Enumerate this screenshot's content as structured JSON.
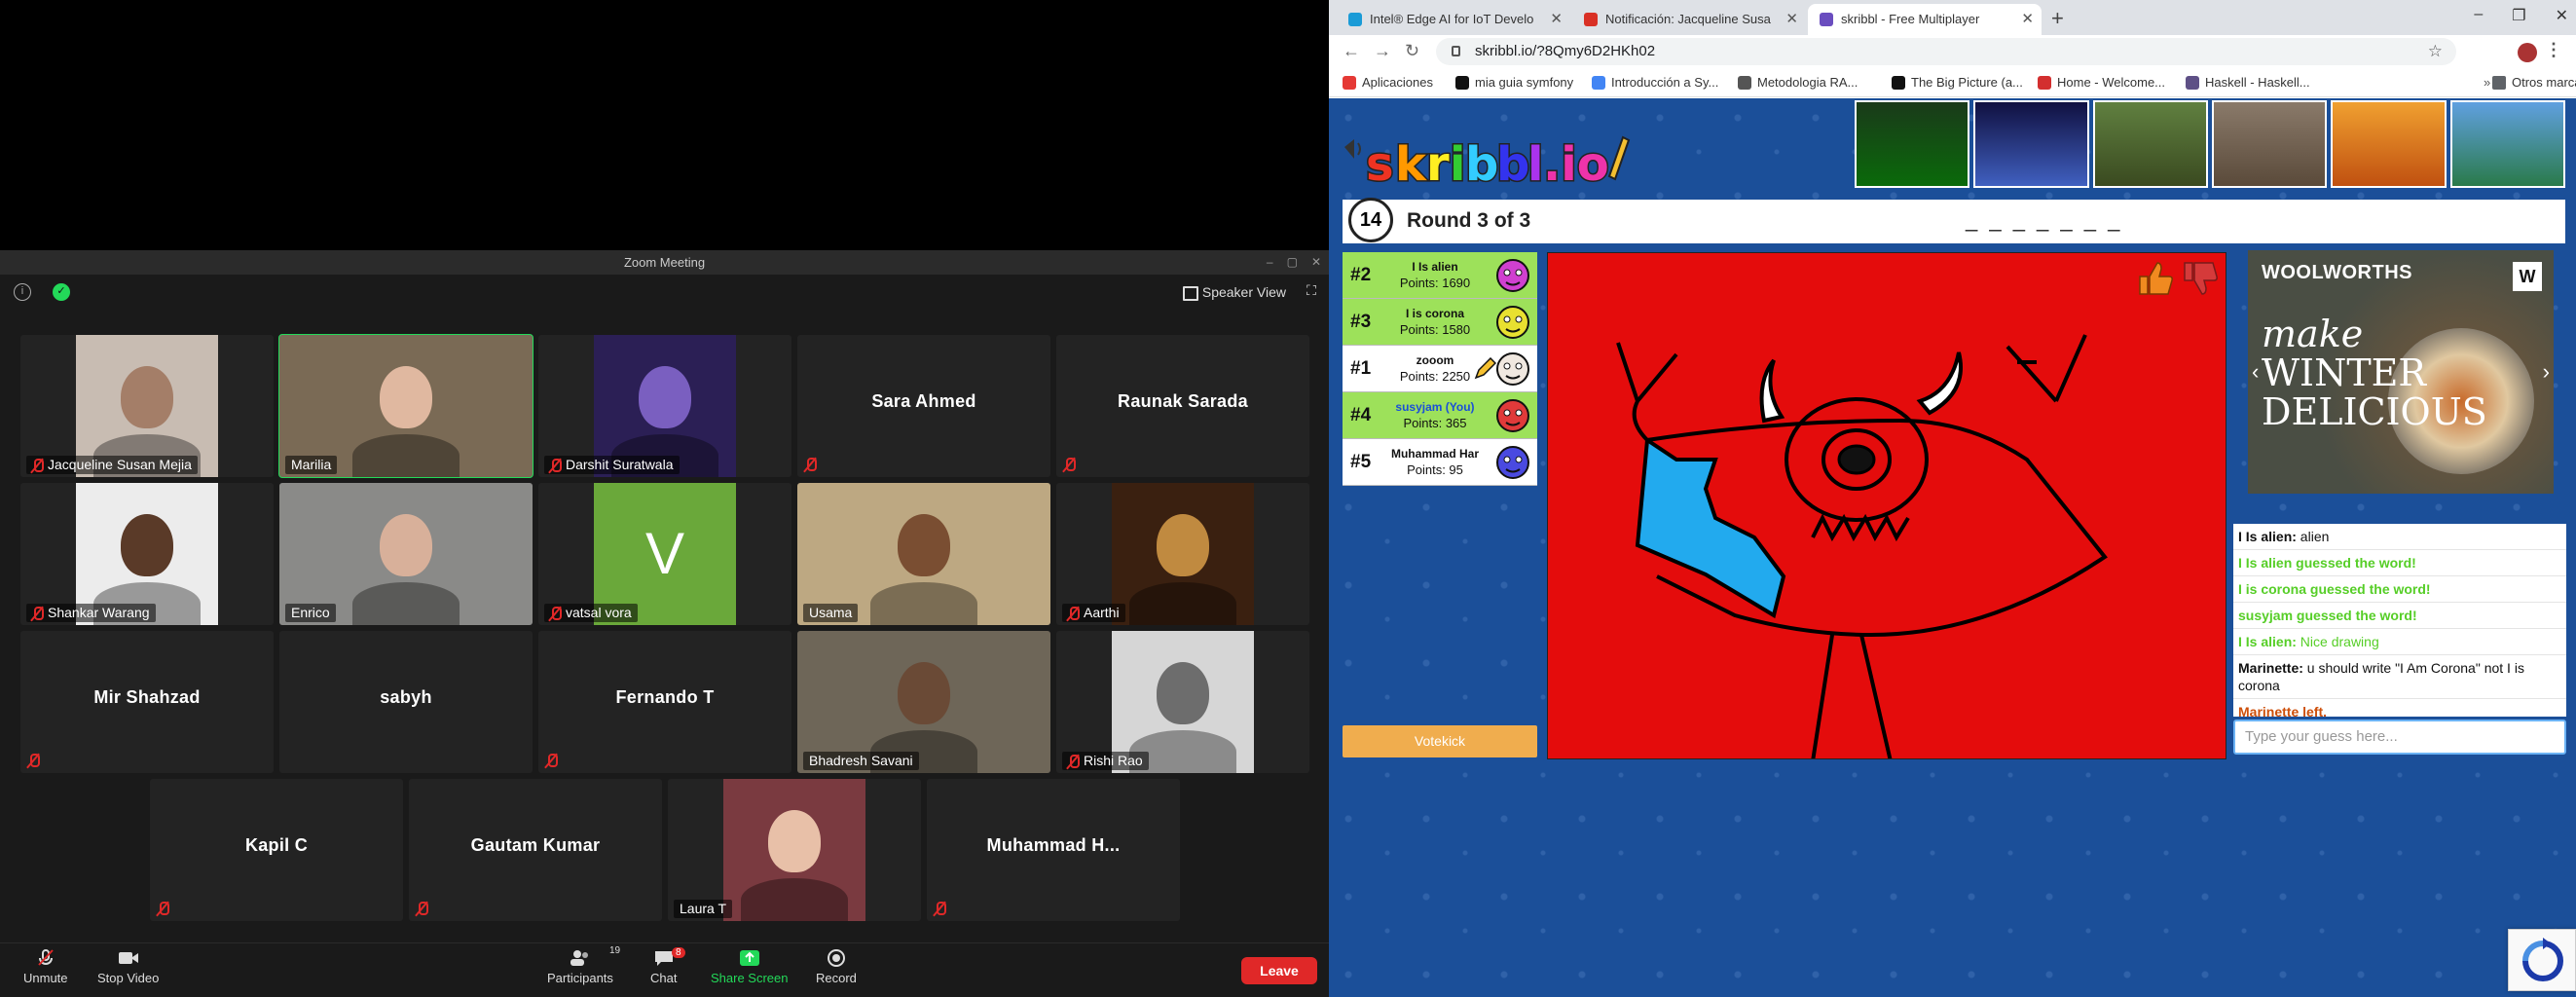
{
  "zoom": {
    "window_title": "Zoom Meeting",
    "speaker_view": "Speaker View",
    "participants": [
      {
        "name": "Jacqueline Susan Mejia",
        "muted": true,
        "video": true,
        "bg": "#c8bcb2",
        "face": "#a47e68"
      },
      {
        "name": "Marilia",
        "muted": false,
        "video": true,
        "active": true,
        "bg": "#7a6a55",
        "face": "#e0b8a0"
      },
      {
        "name": "Darshit Suratwala",
        "muted": true,
        "video": true,
        "bg": "#2b1f55",
        "face": "#7a5fc0"
      },
      {
        "name": "Sara Ahmed",
        "muted": true,
        "video": false
      },
      {
        "name": "Raunak Sarada",
        "muted": true,
        "video": false
      },
      {
        "name": "Shankar Warang",
        "muted": true,
        "video": true,
        "bg": "#ececec",
        "face": "#5a3a28"
      },
      {
        "name": "Enrico",
        "muted": false,
        "video": true,
        "bg": "#8a8a88",
        "face": "#d8b09a"
      },
      {
        "name": "vatsal vora",
        "muted": true,
        "video": false,
        "initial": "V"
      },
      {
        "name": "Usama",
        "muted": false,
        "video": true,
        "bg": "#bda882",
        "face": "#7a4e32"
      },
      {
        "name": "Aarthi",
        "muted": true,
        "video": true,
        "bg": "#3a2010",
        "face": "#c08a40"
      },
      {
        "name": "Mir Shahzad",
        "muted": true,
        "video": false
      },
      {
        "name": "sabyh",
        "muted": false,
        "video": false
      },
      {
        "name": "Fernando T",
        "muted": true,
        "video": false
      },
      {
        "name": "Bhadresh Savani",
        "muted": false,
        "video": true,
        "bg": "#6e6658",
        "face": "#6a4a36"
      },
      {
        "name": "Rishi Rao",
        "muted": true,
        "video": true,
        "bg": "#d6d6d6",
        "face": "#6d6d6d"
      },
      {
        "name": "Kapil C",
        "muted": true,
        "video": false
      },
      {
        "name": "Gautam Kumar",
        "muted": true,
        "video": false
      },
      {
        "name": "Laura T",
        "muted": false,
        "video": true,
        "bg": "#7a3a40",
        "face": "#e8c0a8"
      },
      {
        "name": "Muhammad H...",
        "muted": true,
        "video": false
      }
    ],
    "toolbar": {
      "unmute": "Unmute",
      "stop_video": "Stop Video",
      "participants": "Participants",
      "participants_count": "19",
      "chat": "Chat",
      "chat_badge": "8",
      "share_screen": "Share Screen",
      "record": "Record",
      "leave": "Leave"
    }
  },
  "browser": {
    "tabs": [
      {
        "title": "Intel® Edge AI for IoT Develo",
        "color": "#1a9bd7"
      },
      {
        "title": "Notificación: Jacqueline Susa",
        "color": "#d93025"
      },
      {
        "title": "skribbl - Free Multiplayer",
        "color": "#6a4dbf",
        "active": true
      }
    ],
    "url": "skribbl.io/?8Qmy6D2HKh02",
    "bookmarks": [
      {
        "label": "Aplicaciones",
        "color": "#e53935"
      },
      {
        "label": "mia guia symfony",
        "color": "#111"
      },
      {
        "label": "Introducción a Sy...",
        "color": "#4285f4"
      },
      {
        "label": "Metodologia RA...",
        "color": "#555"
      },
      {
        "label": "The Big Picture (a...",
        "color": "#111"
      },
      {
        "label": "Home - Welcome...",
        "color": "#d32f2f"
      },
      {
        "label": "Haskell - Haskell...",
        "color": "#5e5086"
      }
    ],
    "other_bookmarks": "Otros marcadores"
  },
  "skribbl": {
    "timer": "14",
    "round_text": "Round 3 of 3",
    "word_hint": "_ _ _ _ _ _ _",
    "players": [
      {
        "rank": "#2",
        "name": "I Is alien",
        "points": "Points: 1690",
        "bg": "#9de15a",
        "av": "#d040d0"
      },
      {
        "rank": "#3",
        "name": "I is corona",
        "points": "Points: 1580",
        "bg": "#9de15a",
        "av": "#e8e030"
      },
      {
        "rank": "#1",
        "name": "zooom",
        "points": "Points: 2250",
        "bg": "#ffffff",
        "av": "#f0e8e0",
        "drawing": true
      },
      {
        "rank": "#4",
        "name": "susyjam (You)",
        "points": "Points: 365",
        "bg": "#9de15a",
        "av": "#e03a3a",
        "you": true
      },
      {
        "rank": "#5",
        "name": "Muhammad Har",
        "points": "Points: 95",
        "bg": "#ffffff",
        "av": "#4a4ae0"
      }
    ],
    "votekick": "Votekick",
    "ad_brand": "WOOLWORTHS",
    "ad_headline_1": "make",
    "ad_headline_2": "WINTER",
    "ad_headline_3": "DELICIOUS",
    "chat": [
      {
        "type": "normal",
        "user": "I Is alien:",
        "text": " alien"
      },
      {
        "type": "guess",
        "text": "I Is alien guessed the word!"
      },
      {
        "type": "guess",
        "text": "I is corona guessed the word!"
      },
      {
        "type": "guess",
        "text": "susyjam guessed the word!"
      },
      {
        "type": "green",
        "user": "I Is alien:",
        "text": " Nice drawing"
      },
      {
        "type": "normal",
        "user": "Marinette:",
        "text": " u should write \"I Am Corona\" not I is corona"
      },
      {
        "type": "left",
        "text": "Marinette left."
      }
    ],
    "guess_placeholder": "Type your guess here..."
  }
}
